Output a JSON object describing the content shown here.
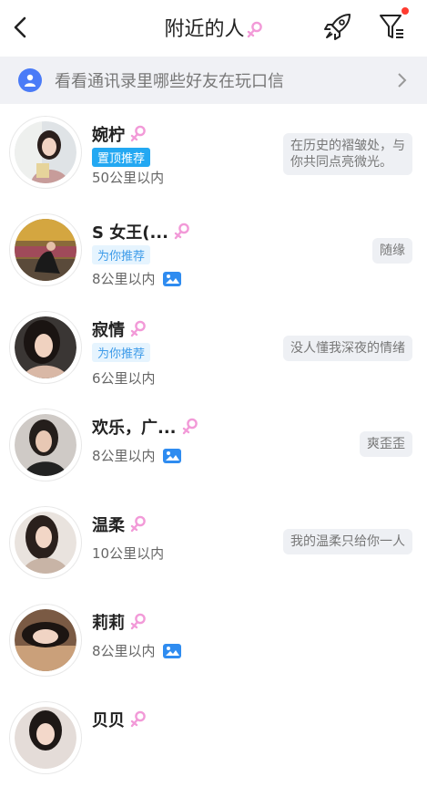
{
  "header": {
    "title": "附近的人"
  },
  "banner": {
    "text": "看看通讯录里哪些好友在玩口信"
  },
  "colors": {
    "accent": "#23a8f2",
    "female": "#f29ad8",
    "notify": "#ff3b30"
  },
  "users": [
    {
      "name": "婉柠",
      "tag": "置顶推荐",
      "tag_type": "top",
      "distance": "50公里以内",
      "has_photo": false,
      "signature_lines": [
        "在历史的褶皱处，与",
        "你共同点亮微光。"
      ]
    },
    {
      "name": "S 女王(...",
      "tag": "为你推荐",
      "tag_type": "rec",
      "distance": "8公里以内",
      "has_photo": true,
      "signature_lines": [
        "随缘"
      ]
    },
    {
      "name": "寂情",
      "tag": "为你推荐",
      "tag_type": "rec",
      "distance": "6公里以内",
      "has_photo": false,
      "signature_lines": [
        "没人懂我深夜的情绪"
      ]
    },
    {
      "name": "欢乐，广...",
      "tag": "",
      "tag_type": "",
      "distance": "8公里以内",
      "has_photo": true,
      "signature_lines": [
        "爽歪歪"
      ]
    },
    {
      "name": "温柔",
      "tag": "",
      "tag_type": "",
      "distance": "10公里以内",
      "has_photo": false,
      "signature_lines": [
        "我的温柔只给你一人"
      ]
    },
    {
      "name": "莉莉",
      "tag": "",
      "tag_type": "",
      "distance": "8公里以内",
      "has_photo": true,
      "signature_lines": []
    },
    {
      "name": "贝贝",
      "tag": "",
      "tag_type": "",
      "distance": "",
      "has_photo": false,
      "signature_lines": []
    }
  ]
}
